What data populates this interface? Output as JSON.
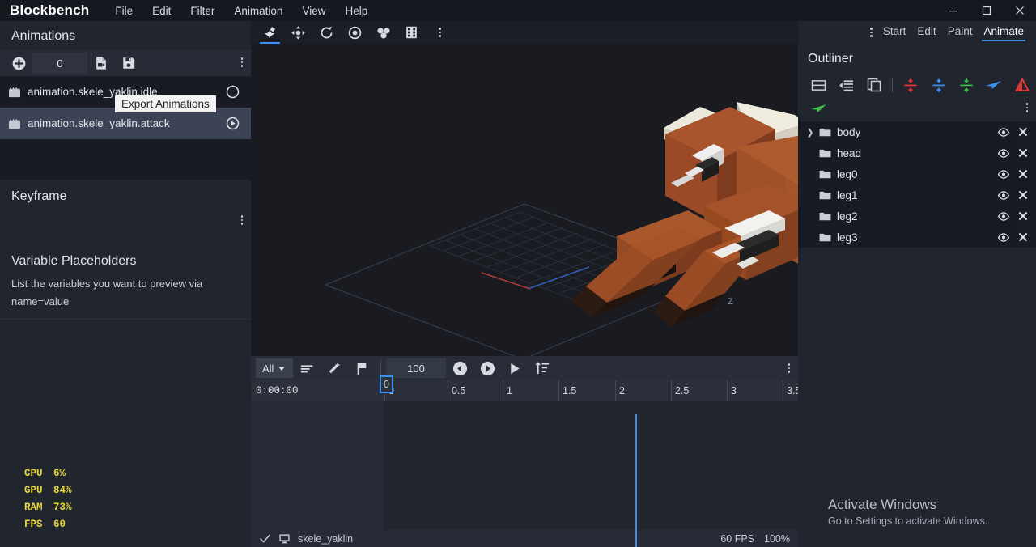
{
  "titlebar": {
    "brand": "Blockbench",
    "menus": [
      "File",
      "Edit",
      "Filter",
      "Animation",
      "View",
      "Help"
    ],
    "window_controls": {
      "minimize": "minimize-icon",
      "maximize": "maximize-icon",
      "close": "close-icon"
    }
  },
  "modebar": {
    "overflow": "more-options-icon",
    "tabs": [
      {
        "label": "Start",
        "active": false
      },
      {
        "label": "Edit",
        "active": false
      },
      {
        "label": "Paint",
        "active": false
      },
      {
        "label": "Animate",
        "active": true
      }
    ],
    "accent": "#3e90f0"
  },
  "left_panel": {
    "animations": {
      "title": "Animations",
      "toolbar": {
        "add_icon": "plus-circle-icon",
        "counter_value": "0",
        "import_icon": "file-video-icon",
        "save_icon": "save-icon",
        "overflow_icon": "more-options-icon"
      },
      "tooltip": "Export Animations",
      "items": [
        {
          "name": "animation.skele_yaklin.idle",
          "icon": "film-icon",
          "selected": false,
          "play_icon": "circle-icon"
        },
        {
          "name": "animation.skele_yaklin.attack",
          "icon": "film-icon",
          "selected": true,
          "play_icon": "play-circle-icon"
        }
      ]
    },
    "keyframe": {
      "title": "Keyframe",
      "overflow_icon": "more-options-icon"
    },
    "variable_placeholders": {
      "title": "Variable Placeholders",
      "description": "List the variables you want to preview via name=value"
    },
    "stats": [
      {
        "key": "CPU",
        "value": "6%"
      },
      {
        "key": "GPU",
        "value": "84%"
      },
      {
        "key": "RAM",
        "value": "73%"
      },
      {
        "key": "FPS",
        "value": "60"
      }
    ],
    "stats_color": "#e8d83a"
  },
  "viewport": {
    "tools": [
      {
        "name": "animate-tool",
        "active": true
      },
      {
        "name": "move-tool",
        "active": false
      },
      {
        "name": "rotate-tool",
        "active": false
      },
      {
        "name": "pivot-tool",
        "active": false
      },
      {
        "name": "bone-tool",
        "active": false
      },
      {
        "name": "effects-tool",
        "active": false
      },
      {
        "name": "more-options",
        "active": false
      }
    ],
    "axis_labels": [
      "Z"
    ],
    "model_name": "skele_yaklin"
  },
  "timeline": {
    "toolbar": {
      "filter_label": "All",
      "graph_icon": "graph-editor-icon",
      "magic_icon": "auto-keyframe-icon",
      "flag_icon": "marker-icon",
      "length_value": "100",
      "prev_icon": "previous-keyframe-icon",
      "next_icon": "next-keyframe-icon",
      "play_icon": "play-icon",
      "sort_icon": "sort-icon",
      "overflow_icon": "more-options-icon"
    },
    "timestamp": "0:00:00",
    "playhead_label": "0",
    "ticks": [
      "0",
      "0.5",
      "1",
      "1.5",
      "2",
      "2.5",
      "3",
      "3.5"
    ],
    "playhead_color": "#3e90f0"
  },
  "statusbar": {
    "check_icon": "check-icon",
    "screen_icon": "monitor-icon",
    "file_name": "skele_yaklin",
    "fps": "60 FPS",
    "zoom": "100%"
  },
  "outliner": {
    "title": "Outliner",
    "toolbar": [
      {
        "name": "add-group-icon",
        "color": "#c9cdd6"
      },
      {
        "name": "outdent-icon",
        "color": "#c9cdd6"
      },
      {
        "name": "duplicate-icon",
        "color": "#c9cdd6"
      },
      {
        "name": "mirror-x-icon",
        "color": "#e03b3b"
      },
      {
        "name": "mirror-y-icon",
        "color": "#3e90f0"
      },
      {
        "name": "mirror-z-icon",
        "color": "#3bc44a"
      },
      {
        "name": "pointer-icon",
        "color": "#3e90f0"
      },
      {
        "name": "warning-triangle-icon",
        "color": "#e03b3b"
      }
    ],
    "toolbar2": [
      {
        "name": "arrow-left-icon",
        "color": "#3bc44a"
      }
    ],
    "overflow_icon": "more-options-icon",
    "columns": [
      "name",
      "visibility",
      "lock"
    ],
    "items": [
      {
        "label": "body",
        "expandable": true,
        "icon": "folder-icon",
        "eye": "eye-icon",
        "close": "x-icon"
      },
      {
        "label": "head",
        "expandable": false,
        "icon": "folder-icon",
        "eye": "eye-icon",
        "close": "x-icon"
      },
      {
        "label": "leg0",
        "expandable": false,
        "icon": "folder-icon",
        "eye": "eye-icon",
        "close": "x-icon"
      },
      {
        "label": "leg1",
        "expandable": false,
        "icon": "folder-icon",
        "eye": "eye-icon",
        "close": "x-icon"
      },
      {
        "label": "leg2",
        "expandable": false,
        "icon": "folder-icon",
        "eye": "eye-icon",
        "close": "x-icon"
      },
      {
        "label": "leg3",
        "expandable": false,
        "icon": "folder-icon",
        "eye": "eye-icon",
        "close": "x-icon"
      }
    ]
  },
  "watermark": {
    "line1": "Activate Windows",
    "line2": "Go to Settings to activate Windows."
  }
}
